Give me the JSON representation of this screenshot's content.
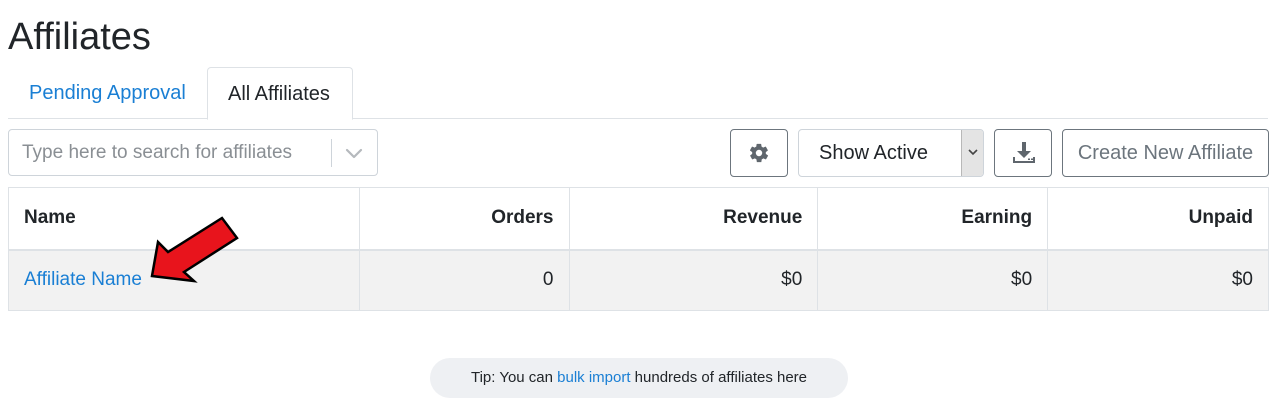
{
  "page": {
    "title": "Affiliates"
  },
  "tabs": [
    {
      "label": "Pending Approval",
      "active": false
    },
    {
      "label": "All Affiliates",
      "active": true
    }
  ],
  "toolbar": {
    "search_placeholder": "Type here to search for affiliates",
    "settings_icon": "gear-icon",
    "status_filter": {
      "selected": "Show Active"
    },
    "download_icon": "download-icon",
    "create_label": "Create New Affiliate"
  },
  "table": {
    "headers": {
      "name": "Name",
      "orders": "Orders",
      "revenue": "Revenue",
      "earning": "Earning",
      "unpaid": "Unpaid"
    },
    "rows": [
      {
        "name": "Affiliate Name",
        "orders": "0",
        "revenue": "$0",
        "earning": "$0",
        "unpaid": "$0"
      }
    ]
  },
  "tip": {
    "prefix": "Tip: You can ",
    "link": "bulk import",
    "suffix": " hundreds of affiliates here"
  },
  "colors": {
    "link": "#1a7fd4",
    "annotation_arrow": "#e8141c",
    "row_background": "#f2f2f2",
    "tip_background": "#eef0f3"
  }
}
